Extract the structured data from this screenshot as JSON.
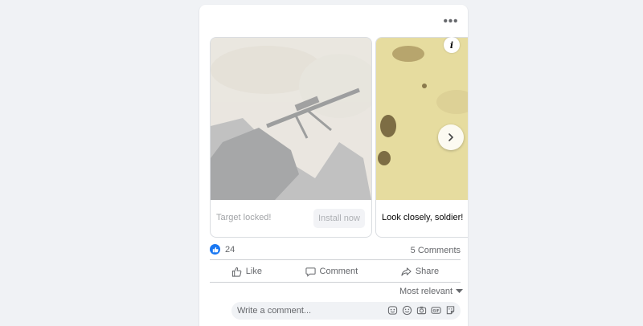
{
  "post": {
    "more_label": "•••",
    "carousel": {
      "cards": [
        {
          "caption": "Target locked!",
          "button_label": "Install now"
        },
        {
          "caption": "Look closely, soldier!"
        }
      ],
      "info_label": "i"
    },
    "reactions": {
      "count": "24",
      "icon": "like-reaction-icon",
      "color": "#1877f2"
    },
    "comments_count": "5 Comments",
    "actions": {
      "like": "Like",
      "comment": "Comment",
      "share": "Share"
    },
    "sort_label": "Most relevant",
    "comment_placeholder": "Write a comment...",
    "comment_icons": [
      "avatar-sticker-icon",
      "emoji-icon",
      "camera-icon",
      "gif-icon",
      "sticker-icon"
    ]
  }
}
